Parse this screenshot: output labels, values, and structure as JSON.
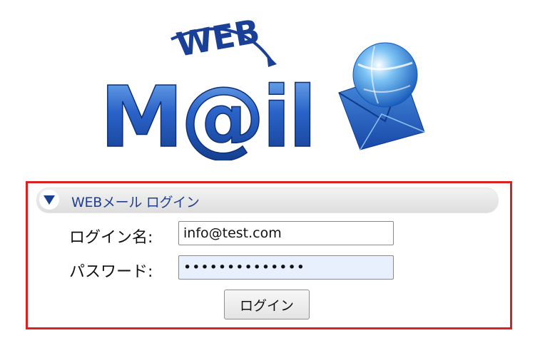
{
  "logo": {
    "top_text": "WEB",
    "main_text": "M@il",
    "icon": "globe-envelope-icon",
    "colors": {
      "primary": "#1a4fb4",
      "dark": "#123a8a",
      "light": "#6fb0f0"
    }
  },
  "login_section": {
    "header_title": "WEBメール ログイン",
    "header_icon": "triangle-down-icon",
    "username_label": "ログイン名:",
    "username_value": "info@test.com",
    "password_label": "パスワード:",
    "password_value": "••••••••••••••",
    "submit_label": "ログイン"
  },
  "colors": {
    "frame_border": "#dd2020",
    "header_text": "#1f3f8f",
    "autofill_bg": "#e8f0fe"
  }
}
